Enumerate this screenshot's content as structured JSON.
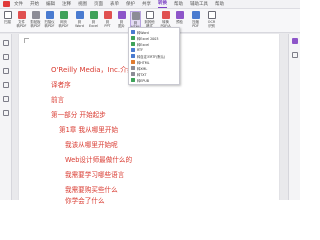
{
  "tabs": [
    "文件",
    "开始",
    "编辑",
    "注释",
    "视图",
    "页面",
    "表单",
    "保护",
    "共享",
    "转换",
    "帮助",
    "辅助工具",
    "帮助"
  ],
  "active_tab": "转换",
  "ribbon": [
    {
      "name": "scan",
      "l1": "扫描",
      "l2": ""
    },
    {
      "name": "file-to-pdf",
      "l1": "文件",
      "l2": "转PDF"
    },
    {
      "name": "clipboard-to-pdf",
      "l1": "剪贴板",
      "l2": "转PDF"
    },
    {
      "name": "scanner-to-pdf",
      "l1": "扫描仪",
      "l2": "转PDF"
    },
    {
      "name": "webpage-to-pdf",
      "l1": "网页",
      "l2": "转PDF"
    },
    {
      "name": "to-word",
      "l1": "到",
      "l2": "Word"
    },
    {
      "name": "to-excel",
      "l1": "到",
      "l2": "Excel"
    },
    {
      "name": "to-ppt",
      "l1": "到",
      "l2": "PPT"
    },
    {
      "name": "to-image",
      "l1": "到",
      "l2": "图片"
    },
    {
      "name": "to-html",
      "l1": "到",
      "l2": "HTML"
    },
    {
      "name": "to-other",
      "l1": "到其他",
      "l2": "格式"
    },
    {
      "name": "to-pdfa",
      "l1": "转换",
      "l2": "PDF/A"
    },
    {
      "name": "preflight",
      "l1": "预检",
      "l2": ""
    },
    {
      "name": "compress",
      "l1": "压缩",
      "l2": "PDF"
    },
    {
      "name": "ocr",
      "l1": "OCR",
      "l2": "识别"
    }
  ],
  "convert_menu": [
    "转Word",
    "转Excel 2003",
    "转Excel",
    "RTF",
    "转自定义RTF(默认)",
    "转HTML",
    "转XML",
    "转TXT",
    "转EPUB"
  ],
  "bookmarks": [
    "O'Reilly Media，Inc.介绍",
    "译者序",
    "前言",
    "第一部分 开始起步",
    "第1章 我从哪里开始",
    "我该从哪里开始呢",
    "Web设计师最做什么的",
    "我需要学习哪些语言",
    "我需要购买些什么",
    "你学会了什么"
  ],
  "colors": {
    "bookmark_text": "#d93a30",
    "accent": "#7b3fc4"
  }
}
